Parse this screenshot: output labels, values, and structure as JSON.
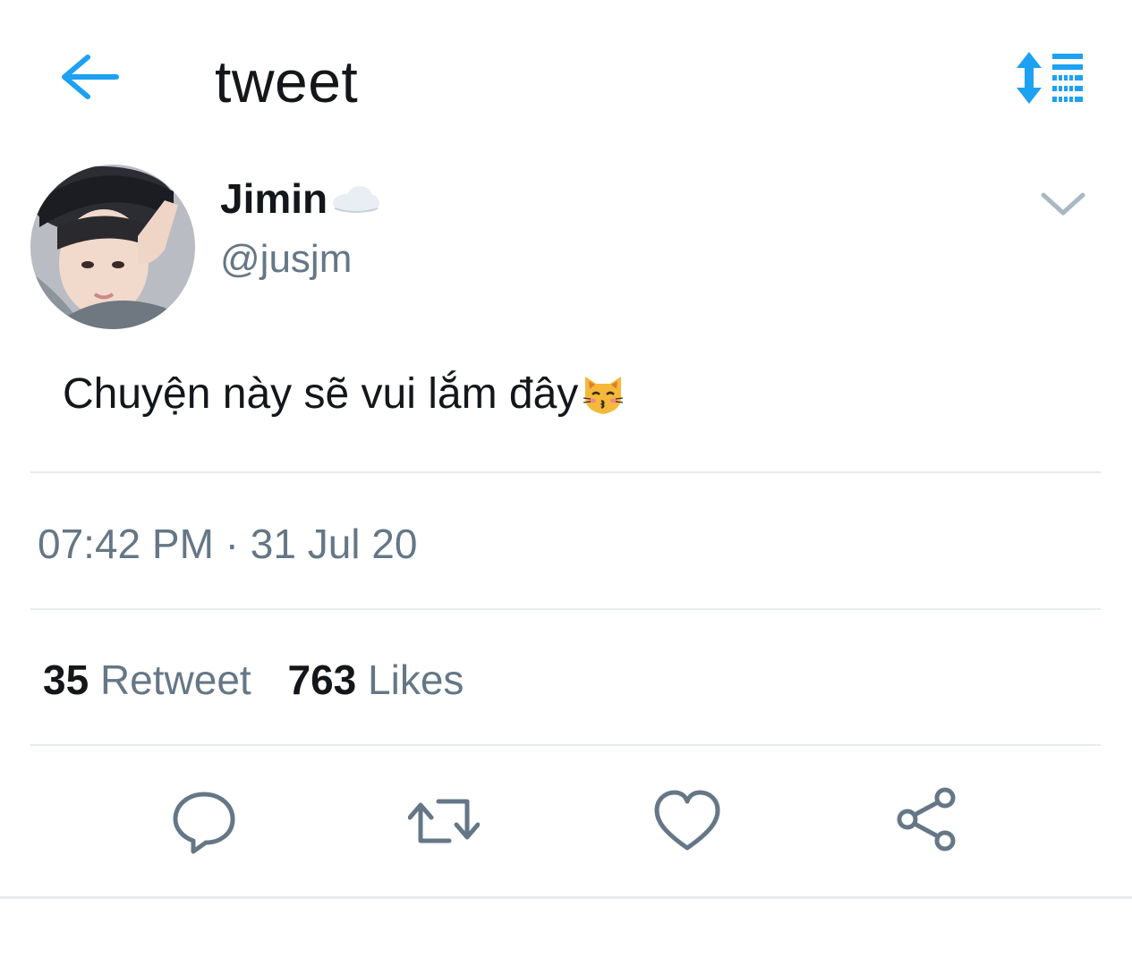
{
  "header": {
    "title": "tweet",
    "accent_color": "#1da1f2"
  },
  "author": {
    "display_name": "Jimin",
    "handle": "@jusjm"
  },
  "tweet": {
    "text": "Chuyện này sẽ vui lắm đây",
    "timestamp": "07:42 PM · 31 Jul 20"
  },
  "stats": {
    "retweet_count": "35",
    "retweet_label": "Retweet",
    "likes_count": "763",
    "likes_label": "Likes"
  },
  "actions": {
    "icons": [
      "reply-icon",
      "retweet-icon",
      "like-icon",
      "share-icon"
    ],
    "icon_color": "#657786"
  }
}
